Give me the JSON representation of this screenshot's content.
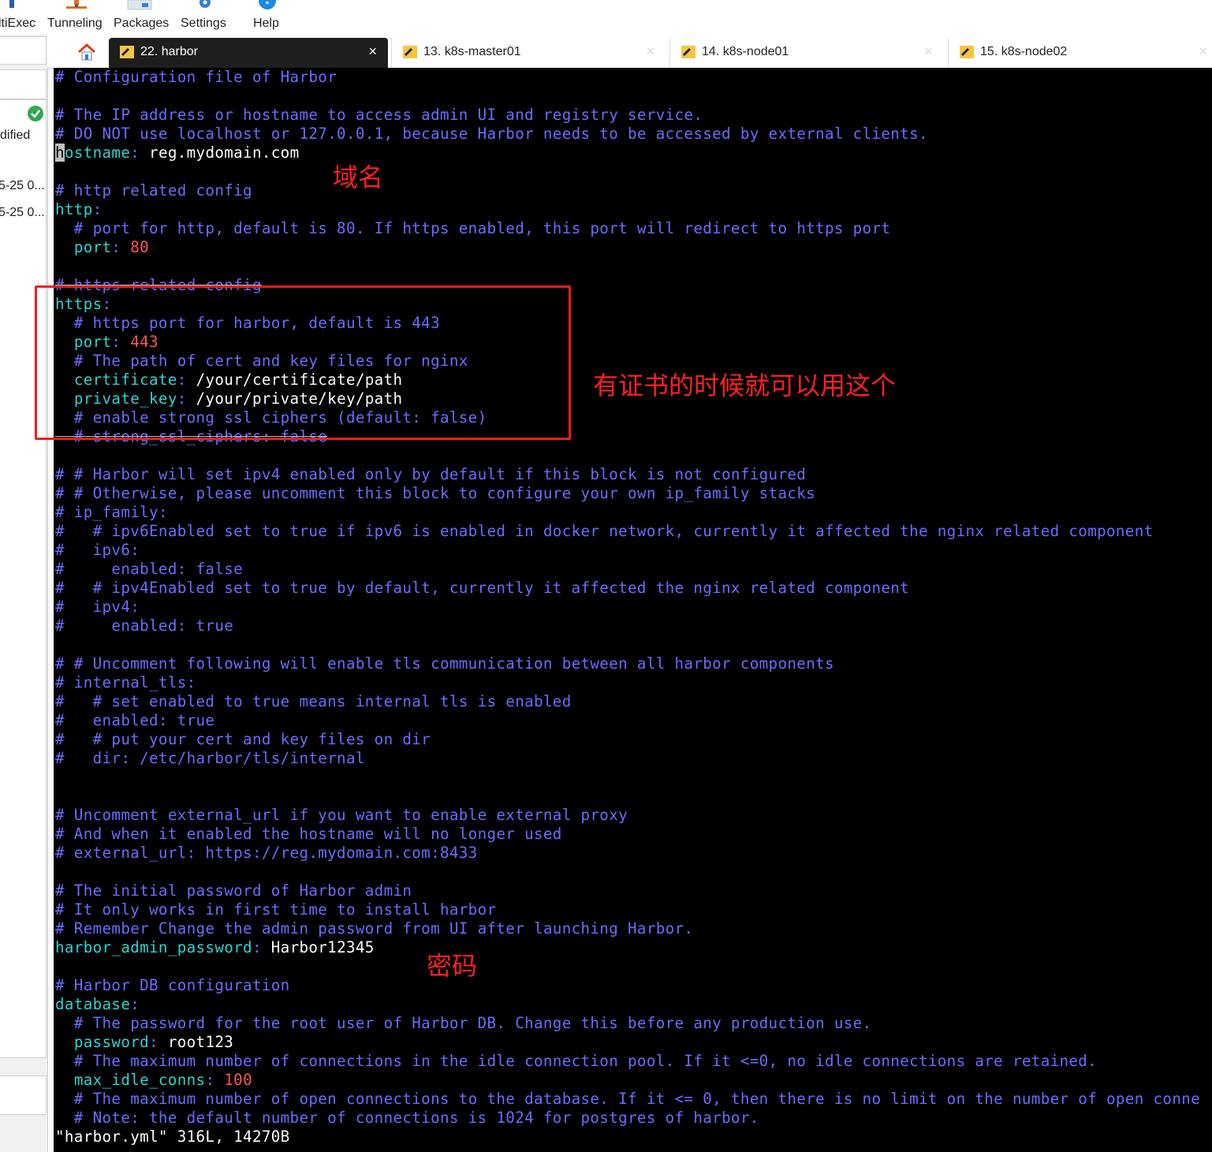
{
  "toolbar": {
    "multiexec": "ltiExec",
    "tunneling": "Tunneling",
    "packages": "Packages",
    "settings": "Settings",
    "help": "Help"
  },
  "left_panel": {
    "status_text": "dified",
    "row1": "5-25 0...",
    "row2": "5-25 0..."
  },
  "tabs": [
    {
      "label": "22. harbor",
      "active": true,
      "close": "×"
    },
    {
      "label": "13. k8s-master01",
      "active": false,
      "close": "×"
    },
    {
      "label": "14. k8s-node01",
      "active": false,
      "close": "×"
    },
    {
      "label": "15. k8s-node02",
      "active": false,
      "close": "×"
    }
  ],
  "terminal": {
    "lines": [
      {
        "segs": [
          {
            "c": "cm",
            "t": "# Configuration file of Harbor"
          }
        ]
      },
      {
        "segs": []
      },
      {
        "segs": [
          {
            "c": "cm",
            "t": "# The IP address or hostname to access admin UI and registry service."
          }
        ]
      },
      {
        "segs": [
          {
            "c": "cm",
            "t": "# DO NOT use localhost or 127.0.0.1, because Harbor needs to be accessed by external clients."
          }
        ]
      },
      {
        "segs": [
          {
            "c": "cursor",
            "t": "h"
          },
          {
            "c": "ky",
            "t": "ostname"
          },
          {
            "c": "cm",
            "t": ":"
          },
          {
            "c": "vl",
            "t": " reg.mydomain.com"
          }
        ]
      },
      {
        "segs": []
      },
      {
        "segs": [
          {
            "c": "cm",
            "t": "# http related config"
          }
        ]
      },
      {
        "segs": [
          {
            "c": "ky",
            "t": "http"
          },
          {
            "c": "cm",
            "t": ":"
          }
        ]
      },
      {
        "segs": [
          {
            "c": "cm",
            "t": "  # port for http, default is 80. If https enabled, this port will redirect to https port"
          }
        ]
      },
      {
        "segs": [
          {
            "c": "vl",
            "t": "  "
          },
          {
            "c": "ky",
            "t": "port"
          },
          {
            "c": "cm",
            "t": ":"
          },
          {
            "c": "nm",
            "t": " 80"
          }
        ]
      },
      {
        "segs": []
      },
      {
        "segs": [
          {
            "c": "cm strike",
            "t": "# https related config"
          }
        ]
      },
      {
        "segs": [
          {
            "c": "ky",
            "t": "https"
          },
          {
            "c": "cm",
            "t": ":"
          }
        ]
      },
      {
        "segs": [
          {
            "c": "cm",
            "t": "  # https port for harbor, default is 443"
          }
        ]
      },
      {
        "segs": [
          {
            "c": "vl",
            "t": "  "
          },
          {
            "c": "ky",
            "t": "port"
          },
          {
            "c": "cm",
            "t": ":"
          },
          {
            "c": "nm",
            "t": " 443"
          }
        ]
      },
      {
        "segs": [
          {
            "c": "cm",
            "t": "  # The path of cert and key files for nginx"
          }
        ]
      },
      {
        "segs": [
          {
            "c": "vl",
            "t": "  "
          },
          {
            "c": "ky",
            "t": "certificate"
          },
          {
            "c": "cm",
            "t": ":"
          },
          {
            "c": "vl",
            "t": " /your/certificate/path"
          }
        ]
      },
      {
        "segs": [
          {
            "c": "vl",
            "t": "  "
          },
          {
            "c": "ky",
            "t": "private_key"
          },
          {
            "c": "cm",
            "t": ":"
          },
          {
            "c": "vl",
            "t": " /your/private/key/path"
          }
        ]
      },
      {
        "segs": [
          {
            "c": "cm",
            "t": "  # enable strong ssl ciphers (default: false)"
          }
        ]
      },
      {
        "segs": [
          {
            "c": "cm strike",
            "t": "  # strong_ssl_ciphers: false"
          }
        ]
      },
      {
        "segs": []
      },
      {
        "segs": [
          {
            "c": "cm",
            "t": "# # Harbor will set ipv4 enabled only by default if this block is not configured"
          }
        ]
      },
      {
        "segs": [
          {
            "c": "cm",
            "t": "# # Otherwise, please uncomment this block to configure your own ip_family stacks"
          }
        ]
      },
      {
        "segs": [
          {
            "c": "cm",
            "t": "# ip_family:"
          }
        ]
      },
      {
        "segs": [
          {
            "c": "cm",
            "t": "#   # ipv6Enabled set to true if ipv6 is enabled in docker network, currently it affected the nginx related component"
          }
        ]
      },
      {
        "segs": [
          {
            "c": "cm",
            "t": "#   ipv6:"
          }
        ]
      },
      {
        "segs": [
          {
            "c": "cm",
            "t": "#     enabled: false"
          }
        ]
      },
      {
        "segs": [
          {
            "c": "cm",
            "t": "#   # ipv4Enabled set to true by default, currently it affected the nginx related component"
          }
        ]
      },
      {
        "segs": [
          {
            "c": "cm",
            "t": "#   ipv4:"
          }
        ]
      },
      {
        "segs": [
          {
            "c": "cm",
            "t": "#     enabled: true"
          }
        ]
      },
      {
        "segs": []
      },
      {
        "segs": [
          {
            "c": "cm",
            "t": "# # Uncomment following will enable tls communication between all harbor components"
          }
        ]
      },
      {
        "segs": [
          {
            "c": "cm",
            "t": "# internal_tls:"
          }
        ]
      },
      {
        "segs": [
          {
            "c": "cm",
            "t": "#   # set enabled to true means internal tls is enabled"
          }
        ]
      },
      {
        "segs": [
          {
            "c": "cm",
            "t": "#   enabled: true"
          }
        ]
      },
      {
        "segs": [
          {
            "c": "cm",
            "t": "#   # put your cert and key files on dir"
          }
        ]
      },
      {
        "segs": [
          {
            "c": "cm",
            "t": "#   dir: /etc/harbor/tls/internal"
          }
        ]
      },
      {
        "segs": []
      },
      {
        "segs": []
      },
      {
        "segs": [
          {
            "c": "cm",
            "t": "# Uncomment external_url if you want to enable external proxy"
          }
        ]
      },
      {
        "segs": [
          {
            "c": "cm",
            "t": "# And when it enabled the hostname will no longer used"
          }
        ]
      },
      {
        "segs": [
          {
            "c": "cm",
            "t": "# external_url: https://reg.mydomain.com:8433"
          }
        ]
      },
      {
        "segs": []
      },
      {
        "segs": [
          {
            "c": "cm",
            "t": "# The initial password of Harbor admin"
          }
        ]
      },
      {
        "segs": [
          {
            "c": "cm",
            "t": "# It only works in first time to install harbor"
          }
        ]
      },
      {
        "segs": [
          {
            "c": "cm",
            "t": "# Remember Change the admin password from UI after launching Harbor."
          }
        ]
      },
      {
        "segs": [
          {
            "c": "ky",
            "t": "harbor_admin_password"
          },
          {
            "c": "cm",
            "t": ":"
          },
          {
            "c": "vl",
            "t": " Harbor12345"
          }
        ]
      },
      {
        "segs": []
      },
      {
        "segs": [
          {
            "c": "cm",
            "t": "# Harbor DB configuration"
          }
        ]
      },
      {
        "segs": [
          {
            "c": "ky",
            "t": "database"
          },
          {
            "c": "cm",
            "t": ":"
          }
        ]
      },
      {
        "segs": [
          {
            "c": "cm",
            "t": "  # The password for the root user of Harbor DB. Change this before any production use."
          }
        ]
      },
      {
        "segs": [
          {
            "c": "vl",
            "t": "  "
          },
          {
            "c": "ky",
            "t": "password"
          },
          {
            "c": "cm",
            "t": ":"
          },
          {
            "c": "vl",
            "t": " root123"
          }
        ]
      },
      {
        "segs": [
          {
            "c": "cm",
            "t": "  # The maximum number of connections in the idle connection pool. If it <=0, no idle connections are retained."
          }
        ]
      },
      {
        "segs": [
          {
            "c": "vl",
            "t": "  "
          },
          {
            "c": "ky",
            "t": "max_idle_conns"
          },
          {
            "c": "cm",
            "t": ":"
          },
          {
            "c": "nm",
            "t": " 100"
          }
        ]
      },
      {
        "segs": [
          {
            "c": "cm",
            "t": "  # The maximum number of open connections to the database. If it <= 0, then there is no limit on the number of open conne"
          }
        ]
      },
      {
        "segs": [
          {
            "c": "cm",
            "t": "  # Note: the default number of connections is 1024 for postgres of harbor."
          }
        ]
      },
      {
        "segs": [
          {
            "c": "vl",
            "t": "\"harbor.yml\" 316L, 14270B"
          }
        ]
      }
    ]
  },
  "annotations": {
    "domain_label": "域名",
    "cert_label": "有证书的时候就可以用这个",
    "password_label": "密码"
  },
  "colors": {
    "comment": "#6a6cff",
    "key": "#2fd2d2",
    "number": "#ff5555",
    "value": "#ffffff",
    "annotation": "#ff2020",
    "terminal_bg": "#000000"
  }
}
